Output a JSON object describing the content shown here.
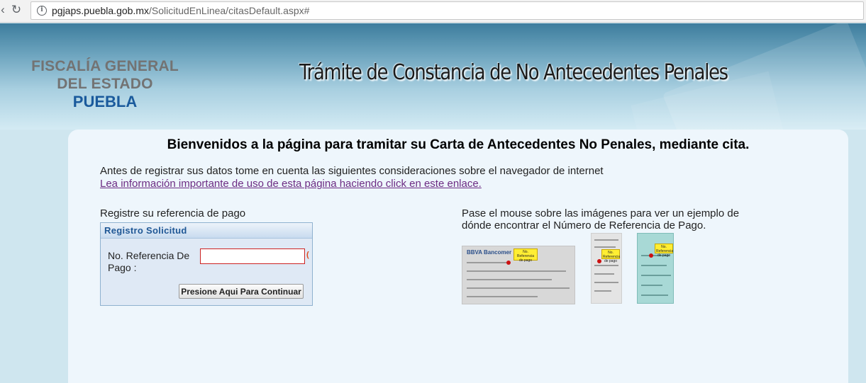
{
  "browser": {
    "back_icon": "back-arrow",
    "reload_icon": "reload",
    "info_icon": "info",
    "url_host": "pgjaps.puebla.gob.mx",
    "url_path": "/SolicitudEnLinea/citasDefault.aspx#"
  },
  "header": {
    "logo_line1": "FISCALÍA GENERAL",
    "logo_line2": "DEL ESTADO",
    "logo_line3": "PUEBLA",
    "title": "Trámite de Constancia de No Antecedentes Penales",
    "logo_colors": {
      "gray": "#737373",
      "blue": "#1a5a9c"
    }
  },
  "main": {
    "welcome": "Bienvenidos a la página para tramitar su Carta de Antecedentes No Penales, mediante cita.",
    "intro_text": "Antes de registrar sus datos tome en cuenta las siguientes consideraciones sobre el navegador de internet",
    "info_link": "Lea información importante de uso de esta página haciendo click en este enlace.",
    "left_label": "Registre su referencia de pago",
    "form": {
      "panel_title": "Registro Solicitud",
      "field_label": "No. Referencia De Pago :",
      "input_value": "",
      "error_mark": "(",
      "continue_button": "Presione Aqui Para Continuar"
    },
    "right_label": "Pase el mouse sobre las imágenes para ver un ejemplo de dónde encontrar el Número de Referencia de Pago.",
    "example_images": {
      "bbva_logo": "BBVA Bancomer",
      "callout_text": "No. Referencia de pago"
    }
  }
}
